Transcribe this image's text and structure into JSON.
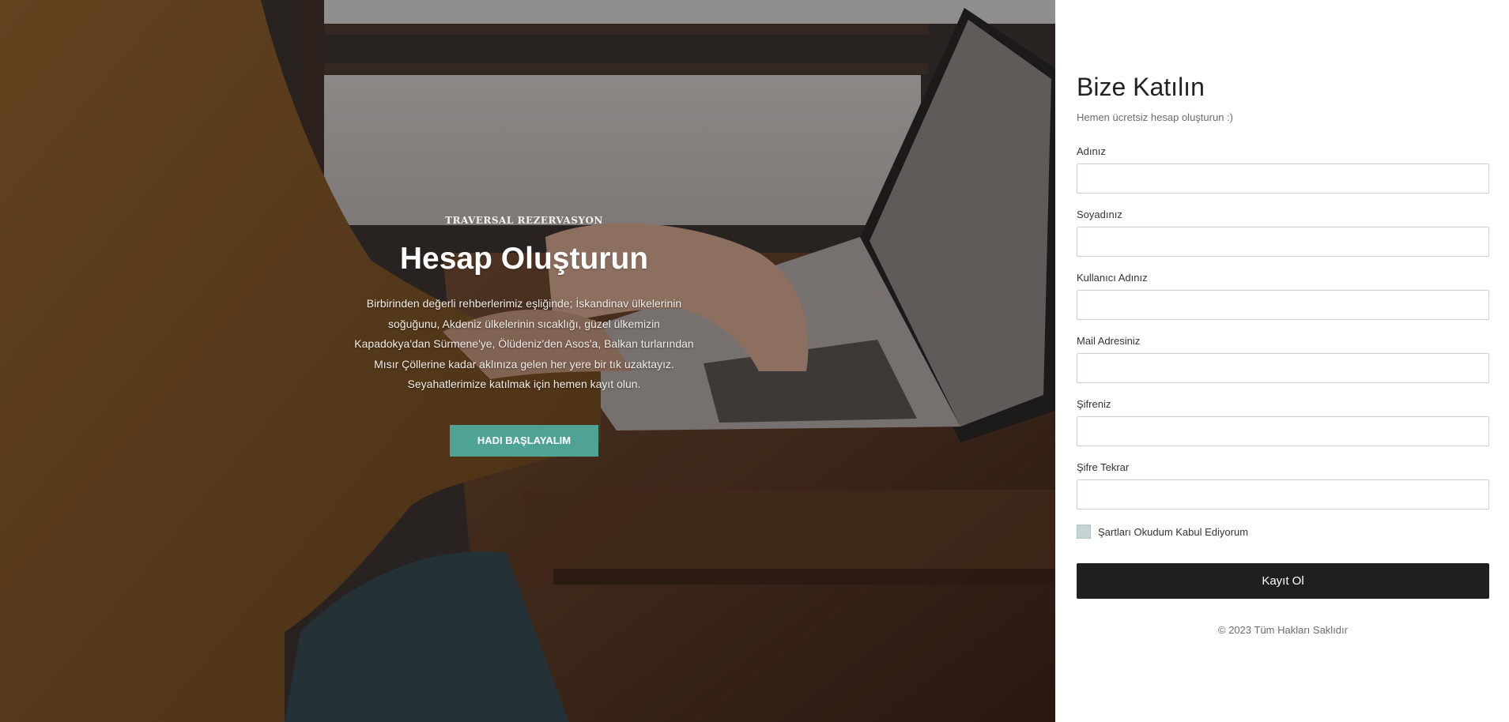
{
  "hero": {
    "eyebrow": "TRAVERSAL REZERVASYON",
    "title": "Hesap Oluşturun",
    "description": "Birbirinden değerli rehberlerimiz eşliğinde; İskandinav ülkelerinin soğuğunu, Akdeniz ülkelerinin sıcaklığı, güzel ülkemizin Kapadokya'dan Sürmene'ye, Ölüdeniz'den Asos'a, Balkan turlarından Mısır Çöllerine kadar aklınıza gelen her yere bir tık uzaktayız. Seyahatlerimize katılmak için hemen kayıt olun.",
    "button_label": "HADI BAŞLAYALIM",
    "accent_color": "#4ea395"
  },
  "form": {
    "title": "Bize Katılın",
    "subtitle": "Hemen ücretsiz hesap oluşturun :)",
    "fields": [
      {
        "label": "Adınız",
        "value": ""
      },
      {
        "label": "Soyadınız",
        "value": ""
      },
      {
        "label": "Kullanıcı Adınız",
        "value": ""
      },
      {
        "label": "Mail Adresiniz",
        "value": ""
      },
      {
        "label": "Şifreniz",
        "value": ""
      },
      {
        "label": "Şifre Tekrar",
        "value": ""
      }
    ],
    "terms_label": "Şartları Okudum Kabul Ediyorum",
    "terms_checked": false,
    "submit_label": "Kayıt Ol",
    "footer": "© 2023 Tüm Hakları Saklıdır"
  }
}
